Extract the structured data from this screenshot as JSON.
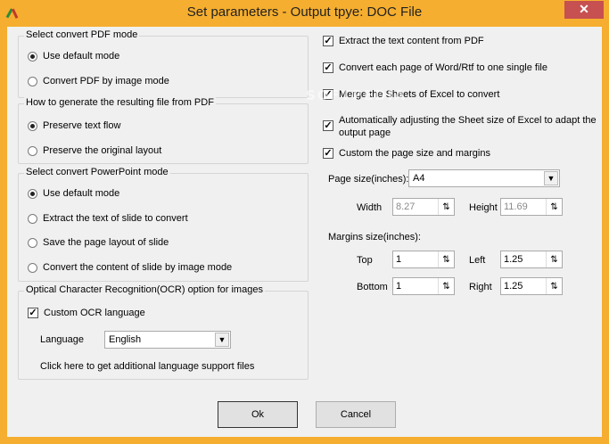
{
  "window": {
    "title": "Set parameters - Output tpye: DOC File",
    "close_glyph": "✕"
  },
  "watermark": "SOFTPEDIA",
  "pdf_mode": {
    "title": "Select convert PDF mode",
    "options": [
      "Use default mode",
      "Convert PDF by image mode"
    ],
    "selected": 0
  },
  "generate": {
    "title": "How to generate the resulting file from PDF",
    "options": [
      "Preserve text flow",
      "Preserve the original layout"
    ],
    "selected": 0
  },
  "ppt_mode": {
    "title": "Select convert PowerPoint mode",
    "options": [
      "Use default mode",
      "Extract the text of slide to convert",
      "Save the page layout of slide",
      "Convert the content of slide by image mode"
    ],
    "selected": 0
  },
  "ocr": {
    "title": "Optical Character Recognition(OCR) option for images",
    "custom_label": "Custom OCR language",
    "custom_checked": true,
    "language_label": "Language",
    "language_value": "English",
    "link_text": "Click here to get additional language support files"
  },
  "options": {
    "extract_text": {
      "label": "Extract the text content from PDF",
      "checked": true
    },
    "convert_each_page": {
      "label": "Convert each page of Word/Rtf to one single file",
      "checked": true
    },
    "merge_sheets": {
      "label": "Merge the Sheets of Excel to convert",
      "checked": true
    },
    "auto_adjust": {
      "label_line1": "Automatically adjusting the Sheet size of Excel to adapt the",
      "label_line2": "output page",
      "checked": true
    },
    "custom_page": {
      "label": "Custom the page size and margins",
      "checked": true
    }
  },
  "page_size": {
    "label": "Page size(inches):",
    "value": "A4",
    "width_label": "Width",
    "width_value": "8.27",
    "height_label": "Height",
    "height_value": "11.69"
  },
  "margins": {
    "label": "Margins size(inches):",
    "top_label": "Top",
    "top_value": "1",
    "left_label": "Left",
    "left_value": "1.25",
    "bottom_label": "Bottom",
    "bottom_value": "1",
    "right_label": "Right",
    "right_value": "1.25"
  },
  "buttons": {
    "ok": "Ok",
    "cancel": "Cancel"
  },
  "glyphs": {
    "check": "✓",
    "spin": "⇅",
    "dropdown": "▼"
  }
}
